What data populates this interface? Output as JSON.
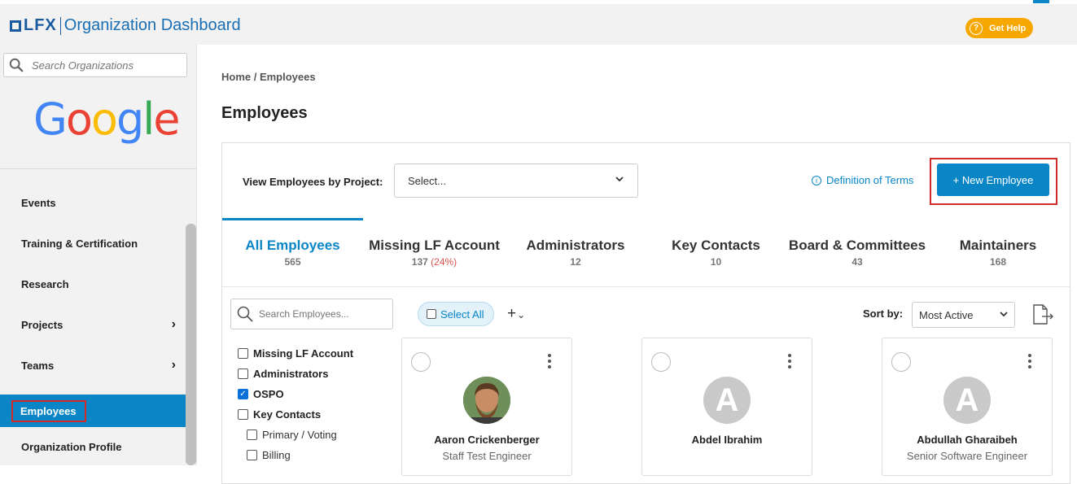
{
  "header": {
    "brand": "LFX",
    "app_title": "Organization Dashboard",
    "help_label": "Get Help"
  },
  "sidebar": {
    "search_placeholder": "Search Organizations",
    "org_logo_text": "Google",
    "items": [
      {
        "label": "Events"
      },
      {
        "label": "Training & Certification"
      },
      {
        "label": "Research"
      },
      {
        "label": "Projects"
      },
      {
        "label": "Teams"
      },
      {
        "label": "Employees"
      },
      {
        "label": "Organization Profile"
      }
    ]
  },
  "breadcrumb": "Home / Employees",
  "page_title": "Employees",
  "toolbar": {
    "project_filter_label": "View Employees by Project:",
    "project_filter_value": "Select...",
    "definitions_label": "Definition of Terms",
    "new_employee_label": "+ New Employee"
  },
  "tabs": [
    {
      "label": "All Employees",
      "count": "565"
    },
    {
      "label": "Missing LF Account",
      "count": "137",
      "pct": "(24%)"
    },
    {
      "label": "Administrators",
      "count": "12"
    },
    {
      "label": "Key Contacts",
      "count": "10"
    },
    {
      "label": "Board & Committees",
      "count": "43"
    },
    {
      "label": "Maintainers",
      "count": "168"
    }
  ],
  "list_controls": {
    "search_placeholder": "Search Employees...",
    "select_all_label": "Select All",
    "sort_label": "Sort by:",
    "sort_value": "Most Active"
  },
  "filters": [
    {
      "label": "Missing LF Account",
      "checked": false
    },
    {
      "label": "Administrators",
      "checked": false
    },
    {
      "label": "OSPO",
      "checked": true
    },
    {
      "label": "Key Contacts",
      "checked": false
    },
    {
      "label": "Primary / Voting",
      "checked": false
    },
    {
      "label": "Billing",
      "checked": false
    }
  ],
  "employees": [
    {
      "name": "Aaron Crickenberger",
      "role": "Staff Test Engineer",
      "avatar": "photo"
    },
    {
      "name": "Abdel Ibrahim",
      "role": "",
      "avatar_initial": "A"
    },
    {
      "name": "Abdullah Gharaibeh",
      "role": "Senior Software Engineer",
      "avatar_initial": "A"
    }
  ],
  "colors": {
    "accent": "#0a86c7",
    "help": "#f7a800",
    "highlight_box": "#d02a2a",
    "percent": "#d9534f"
  }
}
